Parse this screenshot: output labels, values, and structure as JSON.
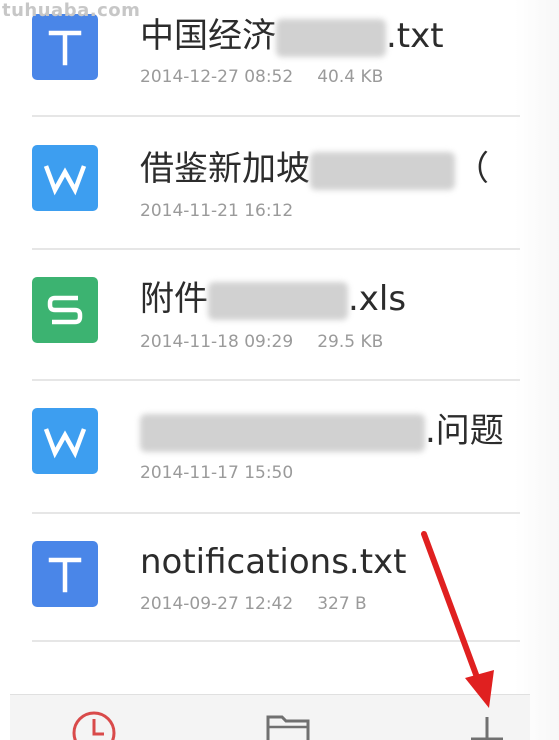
{
  "watermark": "tuhuaba.com",
  "colors": {
    "txt_icon": "#4a86e8",
    "doc_icon": "#3d9ef0",
    "xls_icon": "#3cb371",
    "arrow": "#e02020"
  },
  "files": [
    {
      "icon": "txt-icon",
      "letter": "T",
      "name_prefix": "中国经济",
      "name_suffix": ".txt",
      "date": "2014-12-27 08:52",
      "size": "40.4 KB"
    },
    {
      "icon": "doc-icon",
      "letter": "W",
      "name_prefix": "借鉴新加坡",
      "name_suffix": "（",
      "date": "2014-11-21 16:12",
      "size": ""
    },
    {
      "icon": "xls-icon",
      "letter": "S",
      "name_prefix": "附件",
      "name_suffix": ".xls",
      "date": "2014-11-18 09:29",
      "size": "29.5 KB"
    },
    {
      "icon": "doc-icon",
      "letter": "W",
      "name_prefix": "",
      "name_suffix": ".问题",
      "date": "2014-11-17 15:50",
      "size": ""
    },
    {
      "icon": "txt-icon",
      "letter": "T",
      "name_prefix": "notifications.txt",
      "name_suffix": "",
      "date": "2014-09-27 12:42",
      "size": "327 B"
    }
  ],
  "bottom_tabs": [
    {
      "icon": "recent-clock-icon"
    },
    {
      "icon": "folder-icon"
    },
    {
      "icon": "add-plus-icon"
    }
  ]
}
